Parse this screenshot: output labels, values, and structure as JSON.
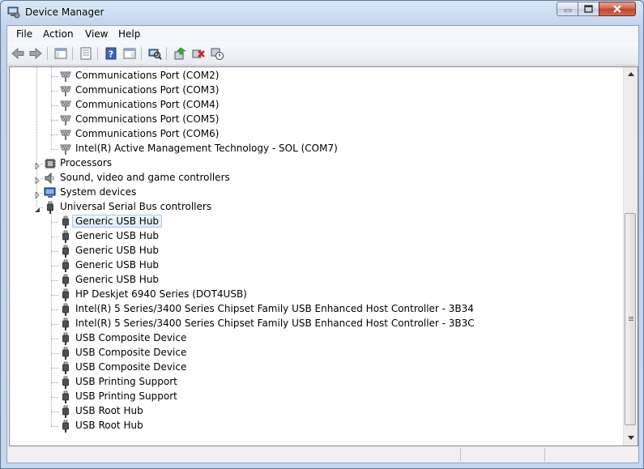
{
  "window": {
    "title": "Device Manager"
  },
  "menu": {
    "file": "File",
    "action": "Action",
    "view": "View",
    "help": "Help"
  },
  "tree": [
    {
      "label": "Communications Port (COM2)",
      "level": 1,
      "icon": "port-icon"
    },
    {
      "label": "Communications Port (COM3)",
      "level": 1,
      "icon": "port-icon"
    },
    {
      "label": "Communications Port (COM4)",
      "level": 1,
      "icon": "port-icon"
    },
    {
      "label": "Communications Port (COM5)",
      "level": 1,
      "icon": "port-icon"
    },
    {
      "label": "Communications Port (COM6)",
      "level": 1,
      "icon": "port-icon"
    },
    {
      "label": "Intel(R) Active Management Technology - SOL (COM7)",
      "level": 1,
      "icon": "port-icon"
    },
    {
      "label": "Processors",
      "level": 0,
      "icon": "processor-icon",
      "expander": "collapsed"
    },
    {
      "label": "Sound, video and game controllers",
      "level": 0,
      "icon": "speaker-icon",
      "expander": "collapsed"
    },
    {
      "label": "System devices",
      "level": 0,
      "icon": "computer-icon",
      "expander": "collapsed"
    },
    {
      "label": "Universal Serial Bus controllers",
      "level": 0,
      "icon": "usb-icon",
      "expander": "expanded"
    },
    {
      "label": "Generic USB Hub",
      "level": 1,
      "icon": "usb-icon",
      "selected": true
    },
    {
      "label": "Generic USB Hub",
      "level": 1,
      "icon": "usb-icon"
    },
    {
      "label": "Generic USB Hub",
      "level": 1,
      "icon": "usb-icon"
    },
    {
      "label": "Generic USB Hub",
      "level": 1,
      "icon": "usb-icon"
    },
    {
      "label": "Generic USB Hub",
      "level": 1,
      "icon": "usb-icon"
    },
    {
      "label": "HP Deskjet 6940 Series (DOT4USB)",
      "level": 1,
      "icon": "usb-icon"
    },
    {
      "label": "Intel(R) 5 Series/3400 Series Chipset Family USB Enhanced Host Controller - 3B34",
      "level": 1,
      "icon": "usb-icon"
    },
    {
      "label": "Intel(R) 5 Series/3400 Series Chipset Family USB Enhanced Host Controller - 3B3C",
      "level": 1,
      "icon": "usb-icon"
    },
    {
      "label": "USB Composite Device",
      "level": 1,
      "icon": "usb-icon"
    },
    {
      "label": "USB Composite Device",
      "level": 1,
      "icon": "usb-icon"
    },
    {
      "label": "USB Composite Device",
      "level": 1,
      "icon": "usb-icon"
    },
    {
      "label": "USB Printing Support",
      "level": 1,
      "icon": "usb-icon"
    },
    {
      "label": "USB Printing Support",
      "level": 1,
      "icon": "usb-icon"
    },
    {
      "label": "USB Root Hub",
      "level": 1,
      "icon": "usb-icon"
    },
    {
      "label": "USB Root Hub",
      "level": 1,
      "icon": "usb-icon"
    }
  ]
}
